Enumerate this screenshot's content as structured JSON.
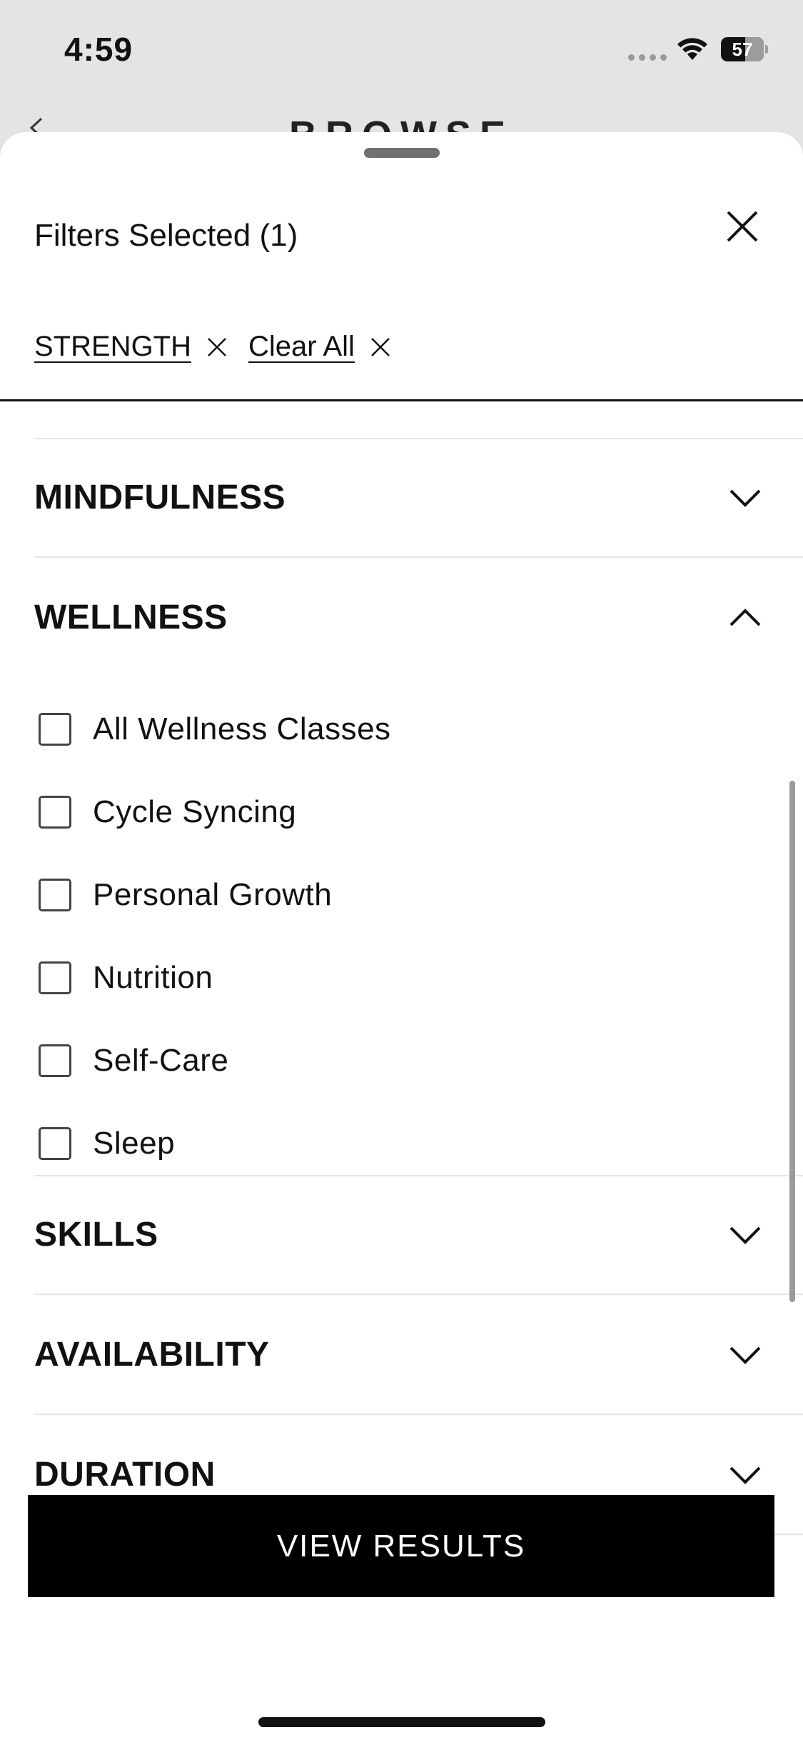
{
  "status_bar": {
    "time": "4:59",
    "battery": "57",
    "battery_level": 0.57
  },
  "background": {
    "title": "BROWSE"
  },
  "sheet": {
    "title": "Filters Selected (1)",
    "chips": [
      {
        "label": "STRENGTH"
      },
      {
        "label": "Clear All"
      }
    ],
    "sections": {
      "mindfulness": {
        "label": "MINDFULNESS",
        "expanded": false
      },
      "wellness": {
        "label": "WELLNESS",
        "expanded": true,
        "options": [
          {
            "label": "All Wellness Classes",
            "checked": false
          },
          {
            "label": "Cycle Syncing",
            "checked": false
          },
          {
            "label": "Personal Growth",
            "checked": false
          },
          {
            "label": "Nutrition",
            "checked": false
          },
          {
            "label": "Self-Care",
            "checked": false
          },
          {
            "label": "Sleep",
            "checked": false
          }
        ]
      },
      "skills": {
        "label": "SKILLS",
        "expanded": false
      },
      "availability": {
        "label": "AVAILABILITY",
        "expanded": false
      },
      "duration": {
        "label": "DURATION",
        "expanded": false
      }
    },
    "view_results": "VIEW RESULTS"
  }
}
